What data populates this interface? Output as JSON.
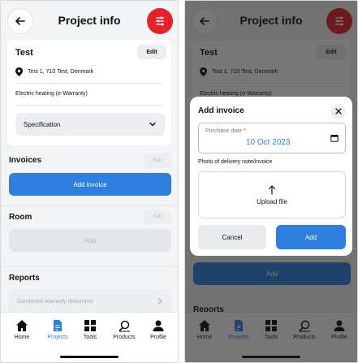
{
  "header": {
    "title": "Project info"
  },
  "project": {
    "name": "Test",
    "edit_label": "Edit",
    "address": "Test 1, 710 Test, Denmark",
    "heating": "Electric heating (e-Warranty)",
    "spec_label": "Specification"
  },
  "invoices": {
    "title": "Invoices",
    "edit_label": "Edit",
    "add_label": "Add invoice"
  },
  "room": {
    "title": "Room",
    "edit_label": "Edit",
    "add_label": "Add"
  },
  "reports": {
    "title": "Reports",
    "item_label": "Combined warranty document"
  },
  "tabs": [
    {
      "label": "Home",
      "icon": "home-icon"
    },
    {
      "label": "Projects",
      "icon": "document-icon",
      "active": true
    },
    {
      "label": "Tools",
      "icon": "grid-icon"
    },
    {
      "label": "Products",
      "icon": "search-icon"
    },
    {
      "label": "Profile",
      "icon": "person-icon"
    }
  ],
  "modal": {
    "title": "Add invoice",
    "date_label": "Purchase date",
    "required_mark": "*",
    "date_value": "10 Oct 2023",
    "photo_label": "Photo of delivery note/invoice",
    "upload_label": "Upload file",
    "cancel_label": "Cancel",
    "add_label": "Add"
  },
  "colors": {
    "accent": "#2f7fe0",
    "brand_red": "#e8202a",
    "background": "#f3f4f6"
  }
}
